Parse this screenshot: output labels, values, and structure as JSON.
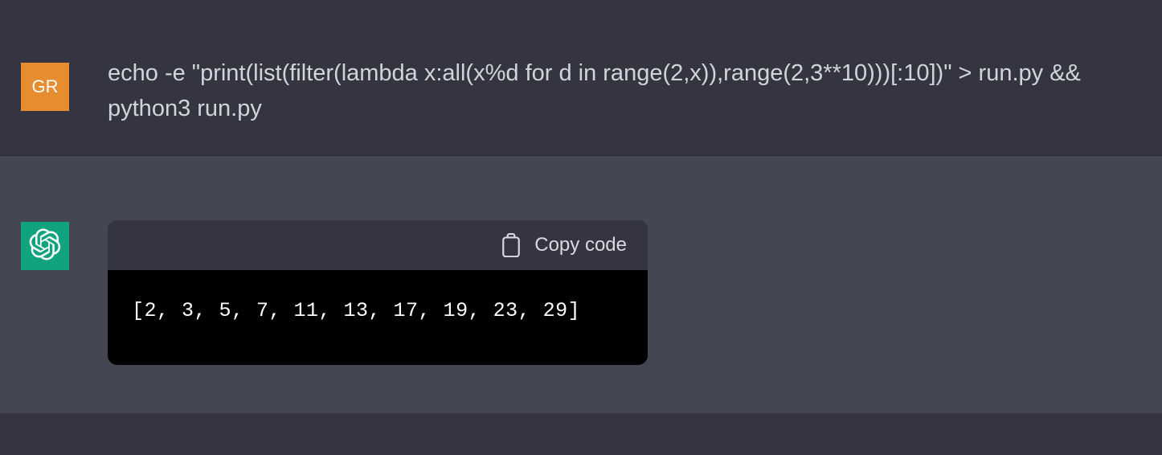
{
  "user": {
    "avatar_initials": "GR",
    "message": "echo -e \"print(list(filter(lambda x:all(x%d for d in range(2,x)),range(2,3**10)))[:10])\" > run.py && python3 run.py"
  },
  "assistant": {
    "copy_label": "Copy code",
    "code_output": "[2, 3, 5, 7, 11, 13, 17, 19, 23, 29]"
  },
  "colors": {
    "user_bg": "#343541",
    "assistant_bg": "#444654",
    "user_avatar": "#e88c30",
    "assistant_avatar": "#10a37f",
    "text": "#d1d5db",
    "code_bg": "#000000"
  }
}
